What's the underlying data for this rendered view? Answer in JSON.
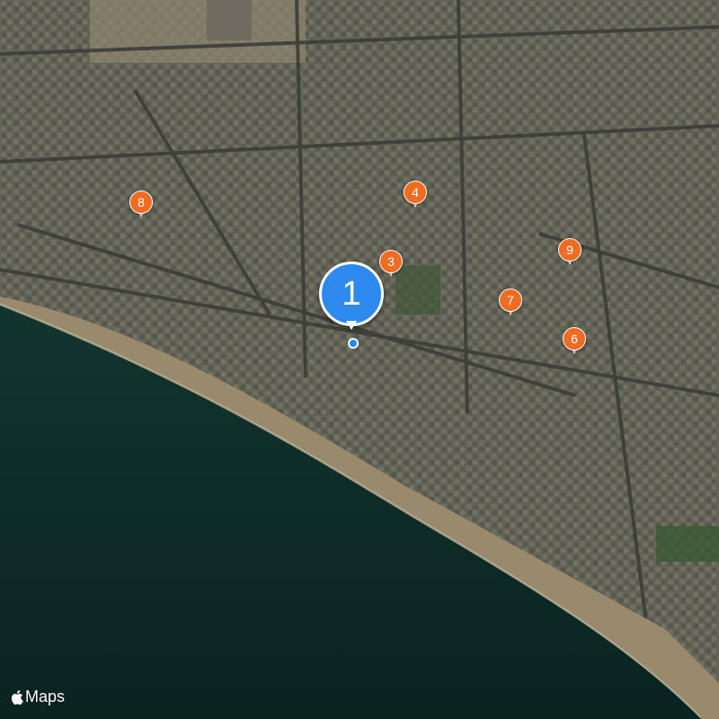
{
  "map": {
    "attribution_text": "Maps",
    "attribution_icon": "apple-logo-icon",
    "cluster": {
      "label": "1",
      "color": "#2f8af0"
    },
    "pins": [
      {
        "label": "3",
        "color": "#f26b22"
      },
      {
        "label": "4",
        "color": "#f26b22"
      },
      {
        "label": "6",
        "color": "#f26b22"
      },
      {
        "label": "7",
        "color": "#f26b22"
      },
      {
        "label": "8",
        "color": "#f26b22"
      },
      {
        "label": "9",
        "color": "#f26b22"
      }
    ]
  }
}
